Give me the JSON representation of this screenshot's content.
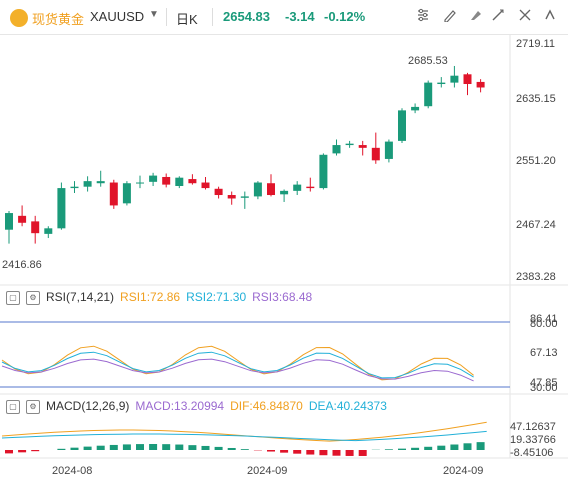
{
  "header": {
    "name": "现货黄金",
    "symbol": "XAUUSD",
    "dropdown_icon": "caret-down",
    "period": "日K",
    "price": "2654.83",
    "change": "-3.14",
    "change_pct": "-0.12%",
    "icons": [
      "settings-icon",
      "draw-icon",
      "eraser-icon",
      "measure-icon",
      "fullscreen-icon",
      "more-icon"
    ]
  },
  "price_axis": {
    "ticks": [
      "2719.11",
      "2635.15",
      "2551.20",
      "2467.24",
      "2383.28"
    ],
    "high_label": "2685.53",
    "low_label": "2416.86"
  },
  "rsi": {
    "title": "RSI(7,14,21)",
    "rsi1": "RSI1:72.86",
    "rsi2": "RSI2:71.30",
    "rsi3": "RSI3:68.48",
    "ticks": [
      "86.41",
      "80.00",
      "67.13",
      "47.85",
      "30.00"
    ],
    "colors": {
      "rsi1": "#f0a020",
      "rsi2": "#22b0d8",
      "rsi3": "#9b6ad0"
    }
  },
  "macd": {
    "title": "MACD(12,26,9)",
    "macd": "MACD:13.20994",
    "dif": "DIF:46.84870",
    "dea": "DEA:40.24373",
    "ticks": [
      "47.12637",
      "19.33766",
      "-8.45106"
    ],
    "colors": {
      "macd": "#9b6ad0",
      "dif": "#f0a020",
      "dea": "#22b0d8"
    }
  },
  "x_axis": {
    "labels": [
      "2024-08",
      "2024-09",
      "2024-09"
    ]
  },
  "colors": {
    "up": "#e0142a",
    "down": "#1a9a7a",
    "accent": "#f0a020"
  },
  "chart_data": {
    "type": "candlestick",
    "ylim": [
      2383.28,
      2719.11
    ],
    "candles": [
      {
        "o": 2450,
        "h": 2477,
        "l": 2430,
        "c": 2474,
        "dir": "up"
      },
      {
        "o": 2470,
        "h": 2485,
        "l": 2455,
        "c": 2460,
        "dir": "down"
      },
      {
        "o": 2462,
        "h": 2470,
        "l": 2430,
        "c": 2445,
        "dir": "down"
      },
      {
        "o": 2444,
        "h": 2455,
        "l": 2438,
        "c": 2452,
        "dir": "up"
      },
      {
        "o": 2452,
        "h": 2518,
        "l": 2450,
        "c": 2510,
        "dir": "up"
      },
      {
        "o": 2510,
        "h": 2520,
        "l": 2503,
        "c": 2512,
        "dir": "up"
      },
      {
        "o": 2512,
        "h": 2527,
        "l": 2505,
        "c": 2520,
        "dir": "up"
      },
      {
        "o": 2517,
        "h": 2535,
        "l": 2512,
        "c": 2520,
        "dir": "up"
      },
      {
        "o": 2518,
        "h": 2522,
        "l": 2480,
        "c": 2485,
        "dir": "down"
      },
      {
        "o": 2488,
        "h": 2520,
        "l": 2485,
        "c": 2517,
        "dir": "up"
      },
      {
        "o": 2517,
        "h": 2528,
        "l": 2510,
        "c": 2518,
        "dir": "up"
      },
      {
        "o": 2519,
        "h": 2532,
        "l": 2513,
        "c": 2528,
        "dir": "up"
      },
      {
        "o": 2526,
        "h": 2531,
        "l": 2511,
        "c": 2515,
        "dir": "down"
      },
      {
        "o": 2513,
        "h": 2527,
        "l": 2510,
        "c": 2525,
        "dir": "up"
      },
      {
        "o": 2523,
        "h": 2530,
        "l": 2515,
        "c": 2517,
        "dir": "down"
      },
      {
        "o": 2518,
        "h": 2526,
        "l": 2508,
        "c": 2510,
        "dir": "down"
      },
      {
        "o": 2509,
        "h": 2512,
        "l": 2495,
        "c": 2500,
        "dir": "down"
      },
      {
        "o": 2500,
        "h": 2505,
        "l": 2486,
        "c": 2495,
        "dir": "down"
      },
      {
        "o": 2496,
        "h": 2505,
        "l": 2480,
        "c": 2498,
        "dir": "up"
      },
      {
        "o": 2498,
        "h": 2520,
        "l": 2494,
        "c": 2518,
        "dir": "up"
      },
      {
        "o": 2517,
        "h": 2530,
        "l": 2498,
        "c": 2500,
        "dir": "down"
      },
      {
        "o": 2501,
        "h": 2508,
        "l": 2490,
        "c": 2506,
        "dir": "up"
      },
      {
        "o": 2506,
        "h": 2520,
        "l": 2500,
        "c": 2515,
        "dir": "up"
      },
      {
        "o": 2512,
        "h": 2525,
        "l": 2505,
        "c": 2510,
        "dir": "down"
      },
      {
        "o": 2510,
        "h": 2560,
        "l": 2508,
        "c": 2558,
        "dir": "up"
      },
      {
        "o": 2560,
        "h": 2580,
        "l": 2557,
        "c": 2572,
        "dir": "up"
      },
      {
        "o": 2572,
        "h": 2578,
        "l": 2568,
        "c": 2574,
        "dir": "up"
      },
      {
        "o": 2572,
        "h": 2578,
        "l": 2557,
        "c": 2568,
        "dir": "down"
      },
      {
        "o": 2568,
        "h": 2590,
        "l": 2545,
        "c": 2550,
        "dir": "down"
      },
      {
        "o": 2552,
        "h": 2580,
        "l": 2547,
        "c": 2577,
        "dir": "up"
      },
      {
        "o": 2578,
        "h": 2625,
        "l": 2575,
        "c": 2622,
        "dir": "up"
      },
      {
        "o": 2622,
        "h": 2632,
        "l": 2618,
        "c": 2627,
        "dir": "up"
      },
      {
        "o": 2628,
        "h": 2665,
        "l": 2625,
        "c": 2662,
        "dir": "up"
      },
      {
        "o": 2660,
        "h": 2670,
        "l": 2655,
        "c": 2662,
        "dir": "up"
      },
      {
        "o": 2662,
        "h": 2686,
        "l": 2655,
        "c": 2672,
        "dir": "up"
      },
      {
        "o": 2674,
        "h": 2676,
        "l": 2644,
        "c": 2660,
        "dir": "down"
      },
      {
        "o": 2663,
        "h": 2667,
        "l": 2648,
        "c": 2655,
        "dir": "down"
      }
    ]
  }
}
